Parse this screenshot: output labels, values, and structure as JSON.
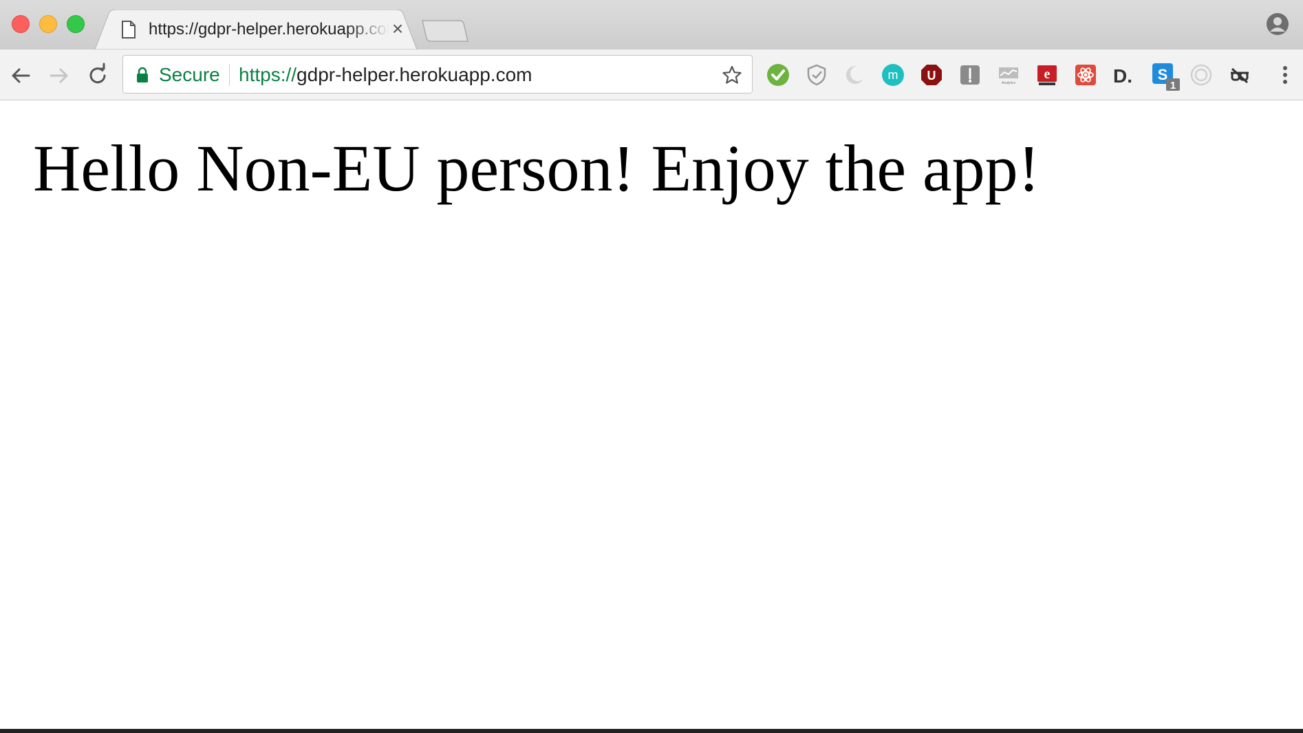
{
  "window": {
    "tab_title": "https://gdpr-helper.herokuapp.com",
    "tab_close_glyph": "×"
  },
  "toolbar": {
    "security_label": "Secure",
    "url_scheme": "https://",
    "url_host": "gdpr-helper.herokuapp.com",
    "extensions": [
      {
        "name": "check-extension-icon",
        "color": "#6cb33f"
      },
      {
        "name": "shield-extension-icon",
        "color": "#9a9a9a"
      },
      {
        "name": "crescent-extension-icon",
        "color": "#c8c8c8"
      },
      {
        "name": "m-extension-icon",
        "color": "#1fbfc0",
        "glyph": "m"
      },
      {
        "name": "ublock-extension-icon",
        "color": "#8b1010",
        "glyph": "U"
      },
      {
        "name": "tool-extension-icon",
        "color": "#7a7a7a"
      },
      {
        "name": "analytics-extension-icon",
        "color": "#9a9a9a",
        "caption": "Analytics"
      },
      {
        "name": "erlang-extension-icon",
        "color": "#c81d25",
        "glyph": "e"
      },
      {
        "name": "react-devtools-extension-icon",
        "color": "#e04a3a"
      },
      {
        "name": "d-extension-icon",
        "color": "#333333",
        "glyph": "D."
      },
      {
        "name": "skype-extension-icon",
        "color": "#1f8bdc",
        "glyph": "S",
        "badge": "1"
      },
      {
        "name": "target-extension-icon",
        "color": "#d0d0d0"
      },
      {
        "name": "glasses-extension-icon",
        "color": "#333333"
      }
    ]
  },
  "page": {
    "heading": "Hello Non-EU person! Enjoy the app!"
  },
  "colors": {
    "secure_green": "#0b8043",
    "tabstrip_bg": "#d3d3d3",
    "toolbar_bg": "#f2f2f2"
  }
}
